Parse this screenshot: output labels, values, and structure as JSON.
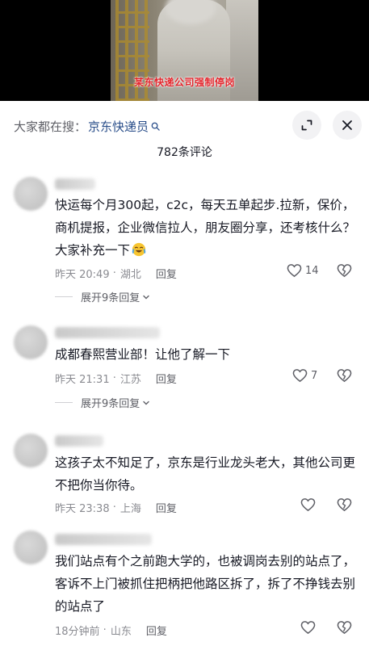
{
  "video": {
    "caption": "某东快递公司强制停岗"
  },
  "sheet": {
    "search_prefix": "大家都在搜：",
    "search_term": "京东快递员",
    "comment_count": "782条评论"
  },
  "comments": [
    {
      "text": "快运每个月300起，c2c，每天五单起步.拉新，保价，商机提报，企业微信拉人，朋友圈分享，还考核什么？大家补充一下",
      "emoji": "crying-laughing-emoji",
      "time": "昨天 20:49",
      "location": "湖北",
      "reply_label": "回复",
      "likes": "14",
      "replies_label": "展开9条回复"
    },
    {
      "text": "成都春熙营业部！让他了解一下",
      "time": "昨天 21:31",
      "location": "江苏",
      "reply_label": "回复",
      "likes": "7",
      "replies_label": "展开9条回复"
    },
    {
      "text": "这孩子太不知足了，京东是行业龙头老大，其他公司更不把你当你待。",
      "time": "昨天 23:38",
      "location": "上海",
      "reply_label": "回复",
      "likes": ""
    },
    {
      "text": "我们站点有个之前跑大学的，也被调岗去别的站点了，客诉不上门被抓住把柄把他路区拆了，拆了不挣钱去别的站点了",
      "time": "18分钟前",
      "location": "山东",
      "reply_label": "回复",
      "likes": ""
    }
  ],
  "colors": {
    "accent_link": "#2a4e8a",
    "caption_red": "#e3242b",
    "meta_gray": "#8a8b91"
  }
}
